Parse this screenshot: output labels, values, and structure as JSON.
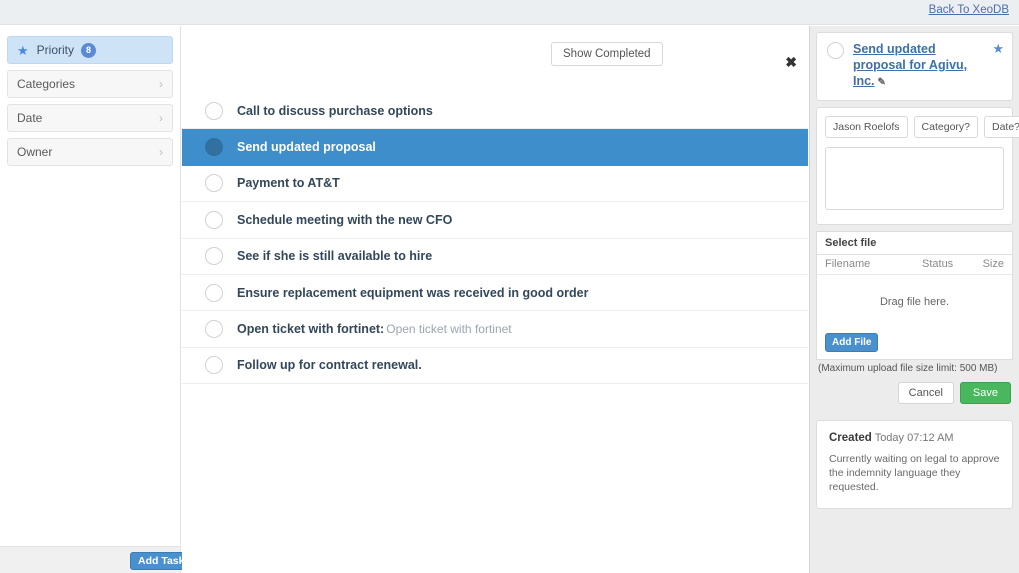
{
  "topbar": {
    "back_link": "Back To XeoDB"
  },
  "sidebar": {
    "items": [
      {
        "label": "Priority",
        "icon": "star-icon",
        "badge": "8",
        "active": true,
        "chevron": false
      },
      {
        "label": "Categories",
        "icon": "",
        "badge": "",
        "active": false,
        "chevron": true
      },
      {
        "label": "Date",
        "icon": "",
        "badge": "",
        "active": false,
        "chevron": true
      },
      {
        "label": "Owner",
        "icon": "",
        "badge": "",
        "active": false,
        "chevron": true
      }
    ],
    "add_task_label": "Add Task"
  },
  "main": {
    "show_completed_label": "Show Completed",
    "close_icon": "✖",
    "tasks": [
      {
        "title": "Call to discuss purchase options",
        "note": "",
        "selected": false
      },
      {
        "title": "Send updated proposal",
        "note": "",
        "selected": true
      },
      {
        "title": "Payment to AT&T",
        "note": "",
        "selected": false
      },
      {
        "title": "Schedule meeting with the new CFO",
        "note": "",
        "selected": false
      },
      {
        "title": "See if she is still available to hire",
        "note": "",
        "selected": false
      },
      {
        "title": "Ensure replacement equipment was received in good order",
        "note": "",
        "selected": false
      },
      {
        "title": "Open ticket with fortinet:",
        "note": "Open ticket with fortinet",
        "selected": false
      },
      {
        "title": "Follow up for contract renewal.",
        "note": "",
        "selected": false
      }
    ]
  },
  "detail": {
    "title": "Send updated proposal for Agivu, Inc.",
    "edit_icon": "✎",
    "star_icon": "★",
    "tags": [
      {
        "label": "Jason Roelofs"
      },
      {
        "label": "Category?"
      },
      {
        "label": "Date?"
      }
    ],
    "notes_value": "",
    "notes_placeholder": "",
    "upload": {
      "header": "Select file",
      "columns": [
        "Filename",
        "Status",
        "Size"
      ],
      "drop_text": "Drag file here.",
      "add_file_label": "Add File",
      "limit_note": "(Maximum upload file size limit: 500 MB)"
    },
    "cancel_label": "Cancel",
    "save_label": "Save",
    "history": {
      "event_label": "Created",
      "event_time": "Today 07:12 AM",
      "body": "Currently waiting on legal to approve the indemnity language they requested."
    }
  },
  "colors": {
    "accent_blue": "#3d8ecb",
    "link_blue": "#3e6fa8",
    "star_blue": "#5b8ad4",
    "save_green": "#49b75d",
    "sidebar_active": "#cfe3f7"
  }
}
